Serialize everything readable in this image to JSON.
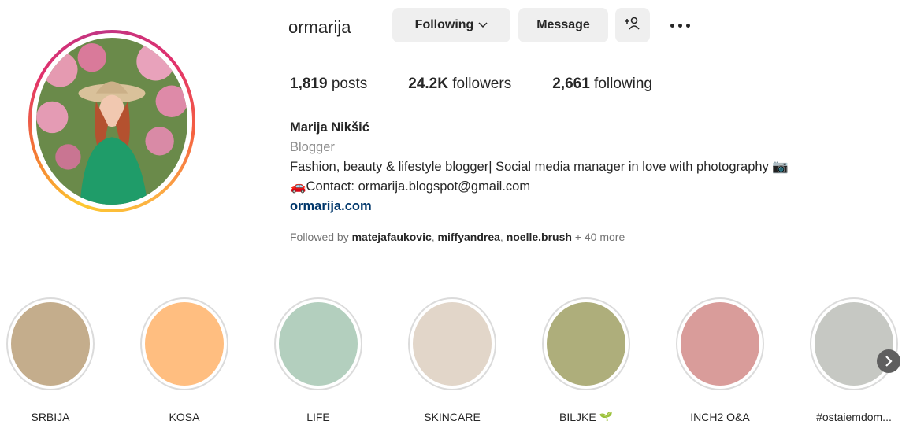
{
  "profile": {
    "username": "ormarija",
    "following_label": "Following",
    "message_label": "Message",
    "posts_count": "1,819",
    "posts_label": "posts",
    "followers_count": "24.2K",
    "followers_label": "followers",
    "following_count": "2,661",
    "following_stat_label": "following",
    "full_name": "Marija Nikšić",
    "category": "Blogger",
    "bio_line1": "Fashion, beauty & lifestyle blogger| Social media manager in love with photography 📷",
    "bio_line2": "🚗Contact: ormarija.blogspot@gmail.com",
    "website": "ormarija.com",
    "followed_by_prefix": "Followed by",
    "followed_by_1": "matejafaukovic",
    "followed_by_2": "miffyandrea",
    "followed_by_3": "noelle.brush",
    "followed_by_more": "+ 40 more"
  },
  "highlights": [
    {
      "label": "SRBIJA",
      "color": "#c4ad8c"
    },
    {
      "label": "KOSA",
      "color": "#ffbe80"
    },
    {
      "label": "LIFE",
      "color": "#b3cfbe"
    },
    {
      "label": "SKINCARE",
      "color": "#e2d6c9"
    },
    {
      "label": "BILJKE 🌱",
      "color": "#aeae7b"
    },
    {
      "label": "INCH2 Q&A",
      "color": "#d99c9a"
    },
    {
      "label": "#ostajemdom...",
      "color": "#c6c8c3"
    }
  ],
  "icons": {
    "chevron": "chevron-down-icon",
    "add_person": "add-person-icon",
    "more": "more-options-icon",
    "next": "chevron-right-icon"
  }
}
